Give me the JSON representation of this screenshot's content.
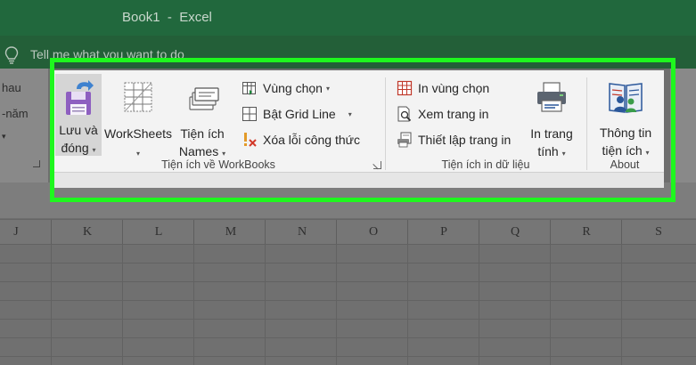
{
  "window": {
    "title": "Book1  -  Excel"
  },
  "tell_me": {
    "placeholder": "Tell me what you want to do"
  },
  "left_fragment": {
    "item1": "hau",
    "item2": "-năm"
  },
  "ribbon": {
    "groups": [
      {
        "label": "Tiện ích về WorkBooks",
        "big_buttons": [
          {
            "line1": "Lưu và",
            "line2": "đóng",
            "icon": "save-icon"
          },
          {
            "line1": "WorkSheets",
            "line2": "",
            "icon": "worksheets-grid-icon"
          },
          {
            "line1": "Tiện ích",
            "line2": "Names",
            "icon": "names-stack-icon"
          }
        ],
        "small_buttons": [
          {
            "label": "Vùng chọn",
            "icon": "selection-icon"
          },
          {
            "label": "Bật Grid Line",
            "icon": "gridline-icon"
          },
          {
            "label": "Xóa lỗi công thức",
            "icon": "clear-error-icon"
          }
        ]
      },
      {
        "label": "Tiện ích in dữ liệu",
        "small_buttons": [
          {
            "label": "In vùng chọn",
            "icon": "print-selection-icon"
          },
          {
            "label": "Xem trang in",
            "icon": "print-preview-icon"
          },
          {
            "label": "Thiết lập trang in",
            "icon": "page-setup-icon"
          }
        ],
        "big_buttons": [
          {
            "line1": "In trang",
            "line2": "tính",
            "icon": "printer-icon"
          }
        ]
      },
      {
        "label": "About",
        "big_buttons": [
          {
            "line1": "Thông tin",
            "line2": "tiện ích",
            "icon": "about-book-icon"
          }
        ]
      }
    ]
  },
  "columns": [
    "J",
    "K",
    "L",
    "M",
    "N",
    "O",
    "P",
    "Q",
    "R",
    "S"
  ],
  "colors": {
    "highlight": "#1ef71e",
    "excel_green": "#21683d",
    "save_purple": "#8e5fc0",
    "print_blue": "#2b579a"
  }
}
